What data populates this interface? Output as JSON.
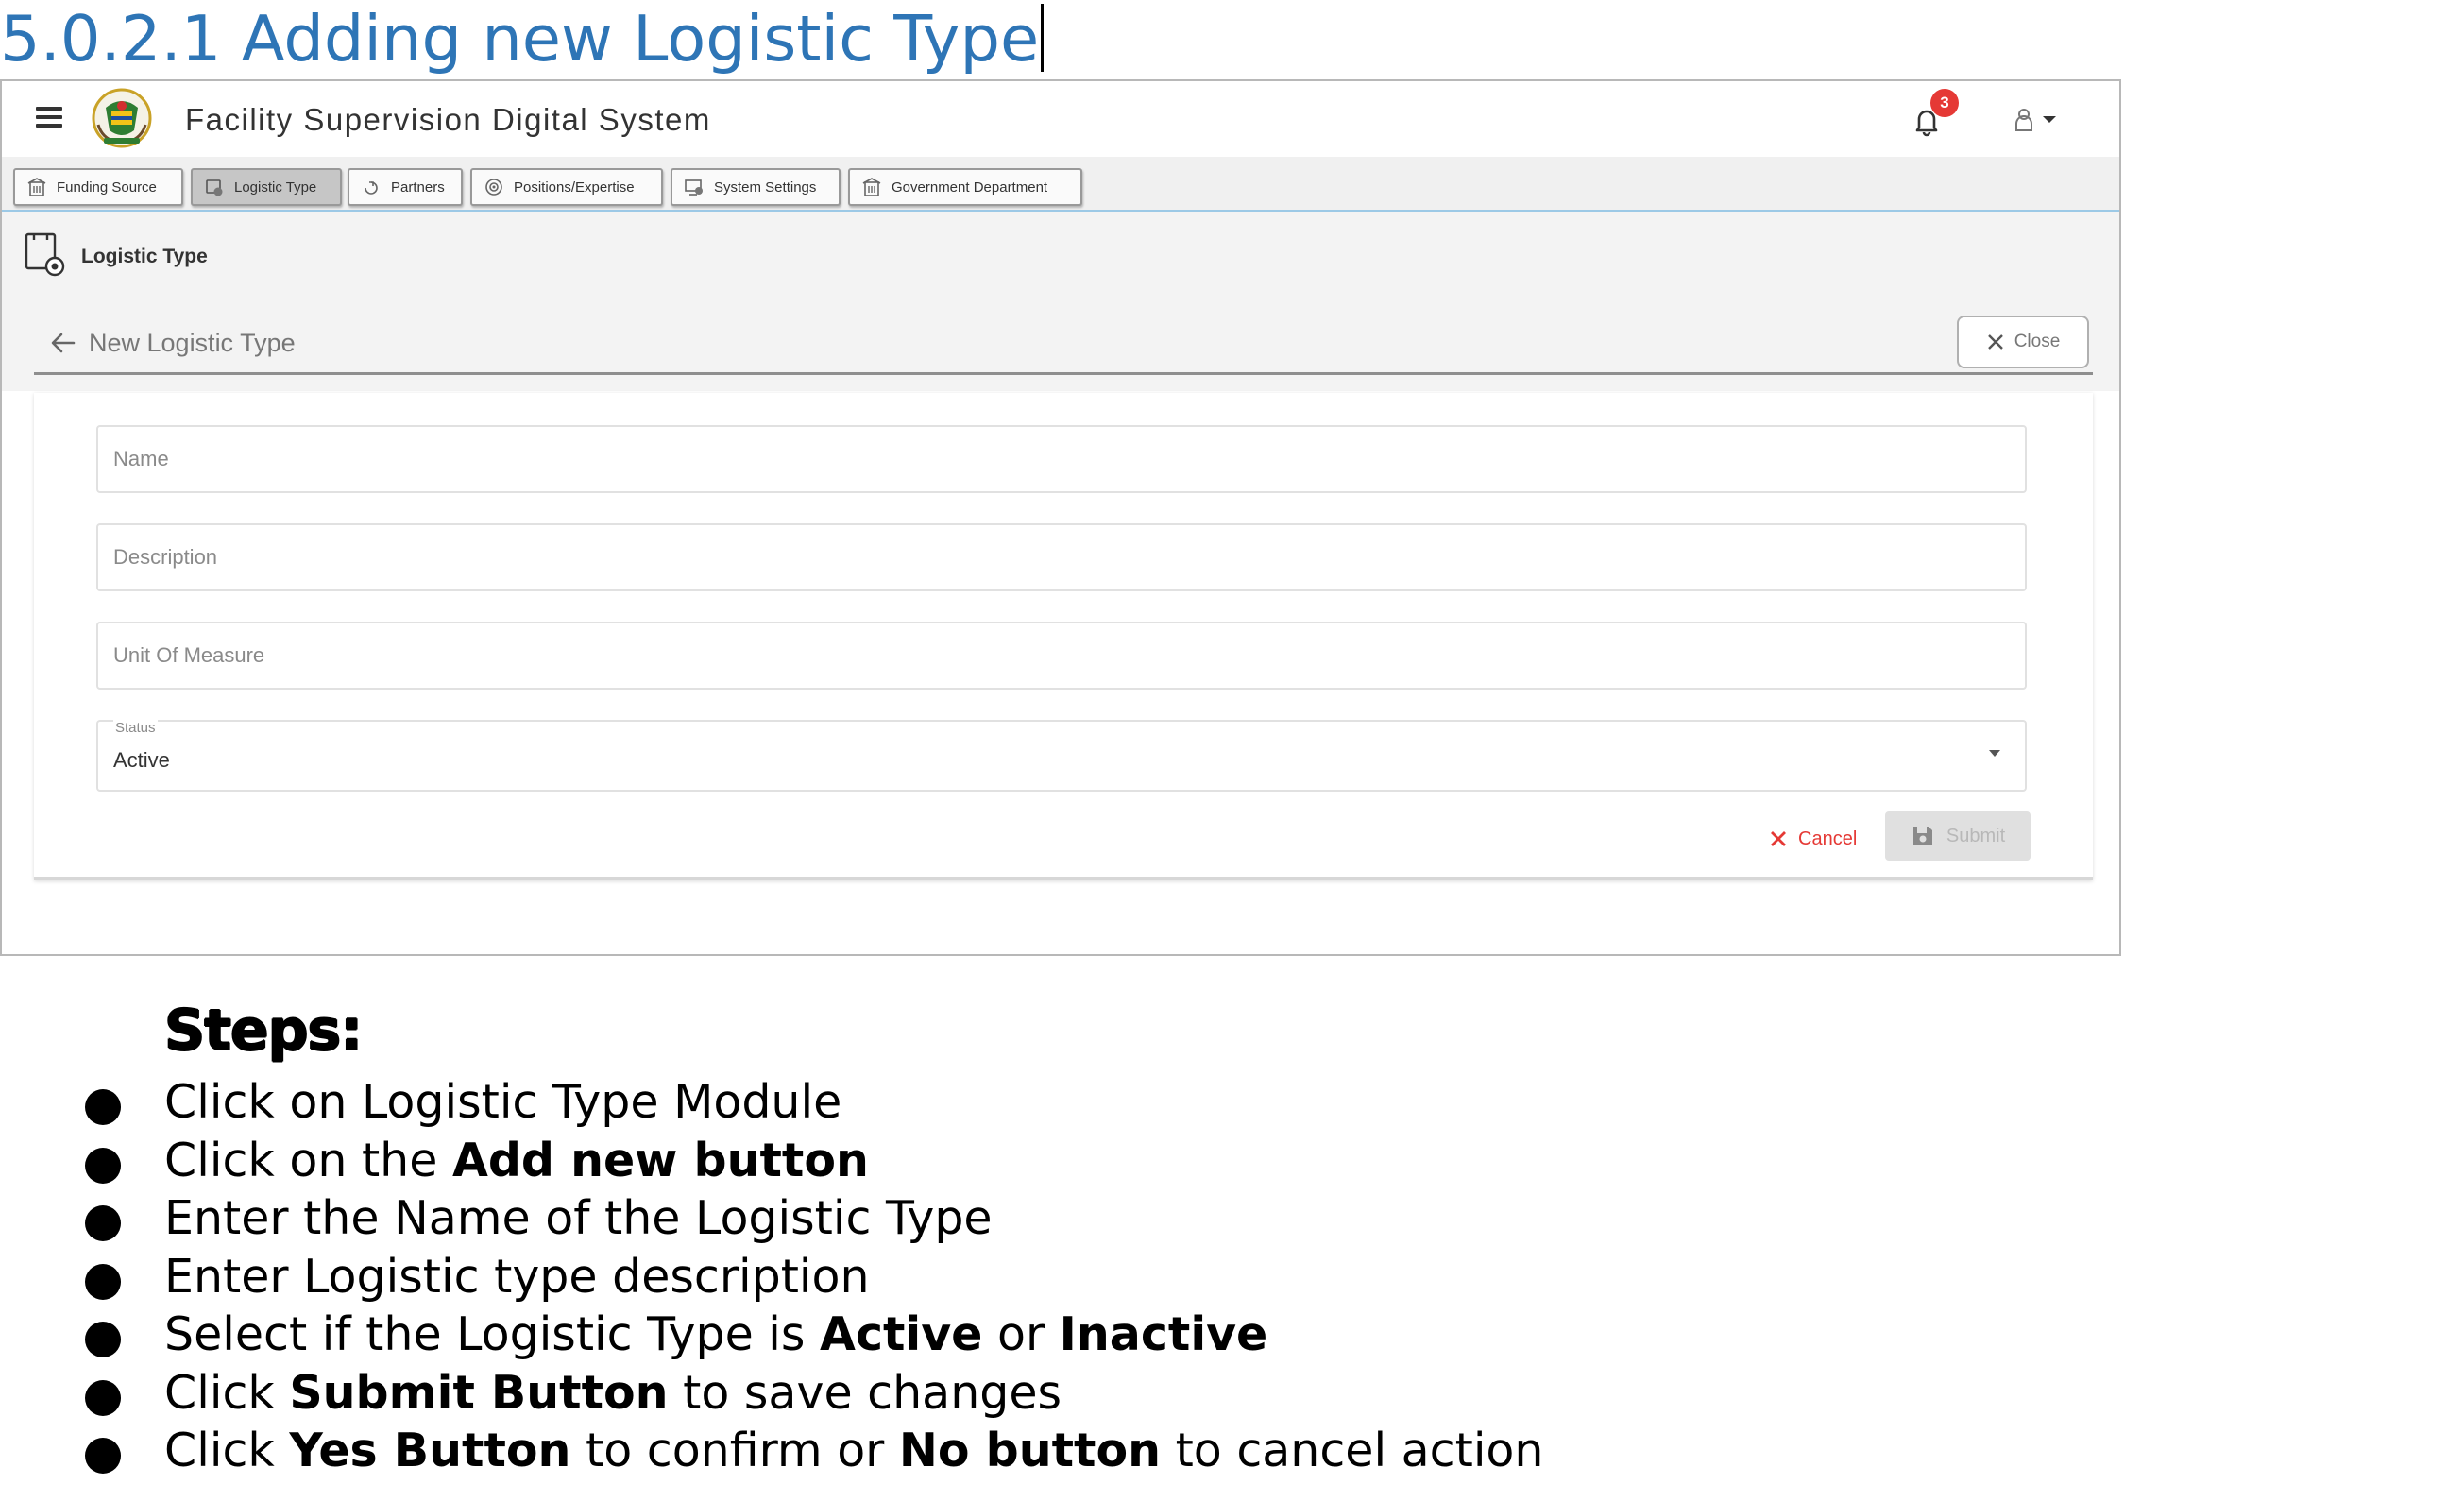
{
  "document": {
    "heading": "5.0.2.1 Adding new Logistic Type"
  },
  "app": {
    "title": "Facility Supervision Digital System",
    "notification_count": "3"
  },
  "tabs": [
    {
      "label": "Funding Source",
      "icon": "building-icon",
      "active": false
    },
    {
      "label": "Logistic Type",
      "icon": "logistic-icon",
      "active": true
    },
    {
      "label": "Partners",
      "icon": "partners-icon",
      "active": false
    },
    {
      "label": "Positions/Expertise",
      "icon": "target-icon",
      "active": false
    },
    {
      "label": "System Settings",
      "icon": "settings-monitor-icon",
      "active": false
    },
    {
      "label": "Government Department",
      "icon": "building-icon",
      "active": false
    }
  ],
  "module": {
    "title": "Logistic Type"
  },
  "form": {
    "title": "New Logistic Type",
    "close_label": "Close",
    "fields": {
      "name_placeholder": "Name",
      "description_placeholder": "Description",
      "unit_placeholder": "Unit Of Measure"
    },
    "status": {
      "label": "Status",
      "value": "Active"
    },
    "cancel_label": "Cancel",
    "submit_label": "Submit"
  },
  "steps": {
    "title": "Steps:",
    "items": [
      [
        {
          "text": "Click on Logistic Type Module",
          "bold": false
        }
      ],
      [
        {
          "text": "Click on the ",
          "bold": false
        },
        {
          "text": "Add new button",
          "bold": true
        }
      ],
      [
        {
          "text": "Enter the Name of the Logistic Type",
          "bold": false
        }
      ],
      [
        {
          "text": "Enter Logistic type description",
          "bold": false
        }
      ],
      [
        {
          "text": "Select if the Logistic Type is ",
          "bold": false
        },
        {
          "text": "Active",
          "bold": true
        },
        {
          "text": " or ",
          "bold": false
        },
        {
          "text": "Inactive",
          "bold": true
        }
      ],
      [
        {
          "text": "Click ",
          "bold": false
        },
        {
          "text": "Submit Button",
          "bold": true
        },
        {
          "text": " to save changes",
          "bold": false
        }
      ],
      [
        {
          "text": "Click ",
          "bold": false
        },
        {
          "text": "Yes Button",
          "bold": true
        },
        {
          "text": " to confirm or ",
          "bold": false
        },
        {
          "text": "No button",
          "bold": true
        },
        {
          "text": " to cancel action",
          "bold": false
        }
      ]
    ]
  },
  "colors": {
    "heading": "#2e75b6",
    "cancel": "#e53935",
    "badge": "#e53935",
    "active_tab": "#c6c6c6"
  }
}
